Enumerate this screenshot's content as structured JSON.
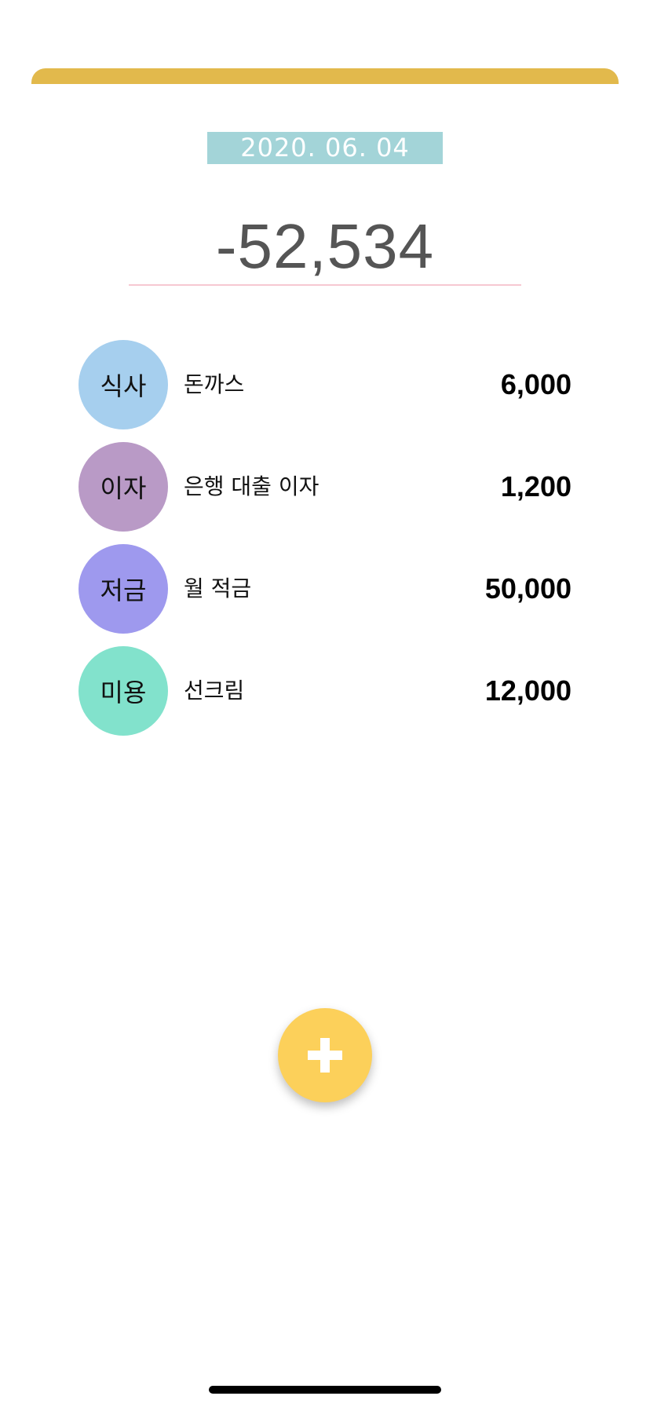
{
  "header": {
    "accent_color": "#e2b94c",
    "date": "2020. 06. 04",
    "date_bg_color": "#a3d4d8"
  },
  "balance": {
    "value": "-52,534",
    "underline_color": "#f7c8d2"
  },
  "expenses": [
    {
      "category": "식사",
      "description": "돈까스",
      "amount": "6,000",
      "color": "#a6cfee"
    },
    {
      "category": "이자",
      "description": "은행 대출 이자",
      "amount": "1,200",
      "color": "#b99ac6"
    },
    {
      "category": "저금",
      "description": "월 적금",
      "amount": "50,000",
      "color": "#9e99ee"
    },
    {
      "category": "미용",
      "description": "선크림",
      "amount": "12,000",
      "color": "#82e2cc"
    }
  ],
  "add_button": {
    "icon": "plus-icon",
    "color": "#fcd05a"
  }
}
